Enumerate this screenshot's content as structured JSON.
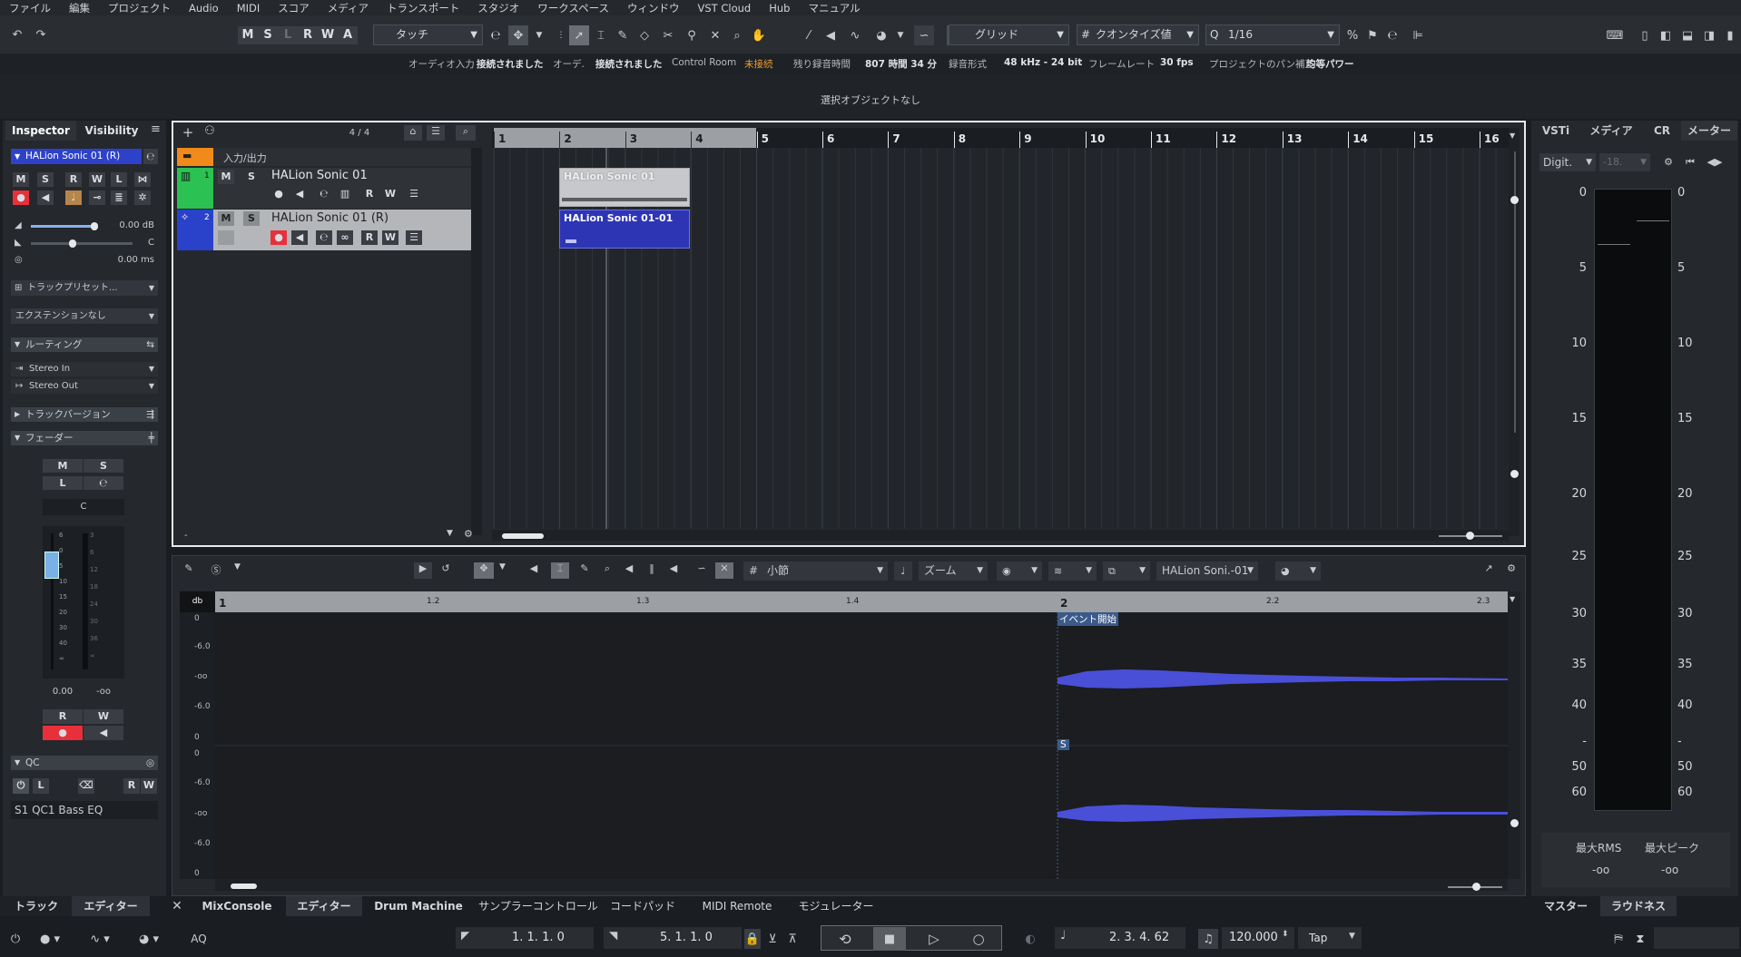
{
  "menu": [
    "ファイル",
    "編集",
    "プロジェクト",
    "Audio",
    "MIDI",
    "スコア",
    "メディア",
    "トランスポート",
    "スタジオ",
    "ワークスペース",
    "ウィンドウ",
    "VST Cloud",
    "Hub",
    "マニュアル"
  ],
  "toolbar": {
    "mode_buttons": [
      "M",
      "S",
      "L",
      "R",
      "W",
      "A"
    ],
    "automation_mode": "タッチ",
    "snap_type": "グリッド",
    "quantize_type": "クオンタイズ値",
    "quantize_value": "1/16"
  },
  "status": {
    "audio_in_label": "オーディオ入力",
    "audio_in_val": "接続されました",
    "audio_out_label": "オーデ.",
    "audio_out_val": "接続されました",
    "control_room_label": "Control Room",
    "control_room_val": "未接続",
    "rec_time_label": "残り録音時間",
    "rec_time_val": "807 時間 34 分",
    "rec_format_label": "録音形式",
    "rec_format_val": "48 kHz - 24 bit",
    "frame_rate_label": "フレームレート",
    "frame_rate_val": "30 fps",
    "pan_label": "プロジェクトのパン補正",
    "pan_val": "均等パワー"
  },
  "info_line": "選択オブジェクトなし",
  "inspector": {
    "tab_inspector": "Inspector",
    "tab_visibility": "Visibility",
    "track_name": "HALion Sonic 01 (R)",
    "buttons_row1": [
      "M",
      "S",
      "R",
      "W",
      "L"
    ],
    "volume": "0.00 dB",
    "pan": "C",
    "delay": "0.00 ms",
    "preset": "トラックプリセット...",
    "extension": "エクステンションなし",
    "routing": "ルーティング",
    "input": "Stereo In",
    "output": "Stereo Out",
    "track_versions": "トラックバージョン",
    "fader": "フェーダー",
    "fader_pan": "C",
    "fader_scale": [
      "6",
      "0",
      "5",
      "10",
      "15",
      "20",
      "30",
      "40",
      "∞"
    ],
    "meter_scale": [
      "3",
      "6",
      "12",
      "18",
      "24",
      "30",
      "36",
      "∞"
    ],
    "fader_value": "0.00",
    "meter_value": "-oo",
    "qc": "QC",
    "qc_slot": "S1 QC1 Bass EQ"
  },
  "tracklist": {
    "counter": "4 / 4",
    "folder_name": "入力/出力",
    "tracks": [
      {
        "num": "1",
        "name": "HALion Sonic 01"
      },
      {
        "num": "2",
        "name": "HALion Sonic 01 (R)"
      }
    ]
  },
  "project": {
    "bars": [
      "1",
      "2",
      "3",
      "4",
      "5",
      "6",
      "7",
      "8",
      "9",
      "10",
      "11",
      "12",
      "13",
      "14",
      "15",
      "16"
    ],
    "events": [
      {
        "name": "HALion Sonic 01"
      },
      {
        "name": "HALion Sonic 01-01"
      }
    ]
  },
  "editor": {
    "grid_type": "小節",
    "zoom": "ズーム",
    "clip": "HALion Soni.-01",
    "ruler": [
      "1",
      "1.2",
      "1.3",
      "1.4",
      "2",
      "2.2",
      "2.3"
    ],
    "db_label": "db",
    "db_scale_top": [
      "0",
      "-6.0",
      "-oo",
      "-6.0",
      "0"
    ],
    "db_scale_bottom": [
      "0",
      "-6.0",
      "-oo",
      "-6.0",
      "0"
    ],
    "event_start": "イベント開始",
    "sync_marker": "S"
  },
  "meter": {
    "tabs": [
      "VSTi",
      "メディア",
      "CR",
      "メーター"
    ],
    "mode": "Digit.",
    "value": "-18.",
    "scale": [
      "0",
      "5",
      "10",
      "15",
      "20",
      "25",
      "30",
      "35",
      "40",
      "-",
      "50",
      "60"
    ],
    "rms_label": "最大RMS",
    "peak_label": "最大ピーク",
    "rms_value": "-oo",
    "peak_value": "-oo",
    "bottom_tabs": [
      "マスター",
      "ラウドネス"
    ]
  },
  "bottom_tabs": {
    "left": [
      "トラック",
      "エディター"
    ],
    "main": [
      "MixConsole",
      "エディター",
      "Drum Machine",
      "サンプラーコントロール",
      "コードパッド",
      "MIDI Remote",
      "モジュレーター"
    ]
  },
  "transport": {
    "left_locator": "1. 1. 1.   0",
    "right_locator": "5. 1. 1.   0",
    "position": "2. 3. 4. 62",
    "tempo": "120.000",
    "tap": "Tap",
    "aq": "AQ"
  }
}
